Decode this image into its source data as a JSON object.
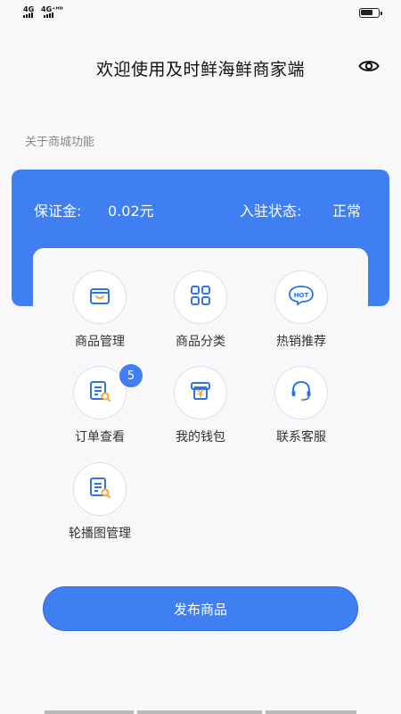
{
  "status_bar": {
    "network_1": "4G",
    "network_2": "4G⁺ᴴᴰ"
  },
  "header": {
    "title": "欢迎使用及时鲜海鲜商家端"
  },
  "section": {
    "label": "关于商城功能"
  },
  "account": {
    "deposit_label": "保证金:",
    "deposit_value": "0.02元",
    "status_label": "入驻状态:",
    "status_value": "正常"
  },
  "menu": {
    "items": [
      {
        "label": "商品管理",
        "icon": "basket-icon"
      },
      {
        "label": "商品分类",
        "icon": "grid-icon"
      },
      {
        "label": "热销推荐",
        "icon": "hot-badge-icon",
        "icon_text": "HOT"
      },
      {
        "label": "订单查看",
        "icon": "order-search-icon",
        "badge": "5"
      },
      {
        "label": "我的钱包",
        "icon": "wallet-icon"
      },
      {
        "label": "联系客服",
        "icon": "headset-icon"
      },
      {
        "label": "轮播图管理",
        "icon": "document-search-icon"
      }
    ]
  },
  "actions": {
    "publish_label": "发布商品"
  },
  "colors": {
    "accent": "#3f7ff2",
    "icon_outline": "#2f73e8",
    "icon_highlight": "#f0a93a",
    "background": "#f8f8fa"
  }
}
